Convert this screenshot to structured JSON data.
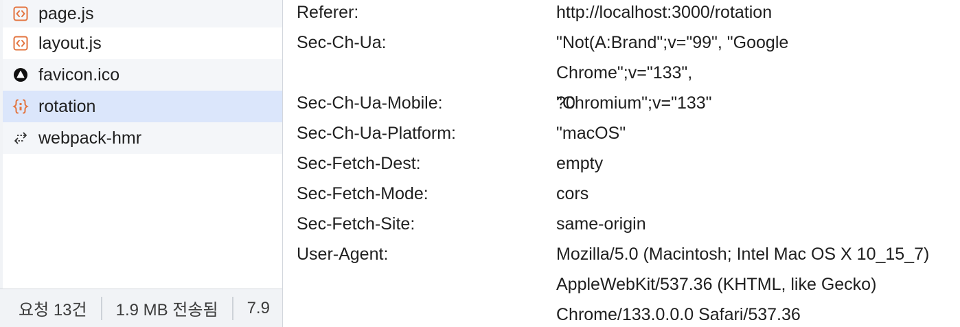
{
  "requests": [
    {
      "name": "page.js",
      "icon": "script-icon",
      "state": "normal"
    },
    {
      "name": "layout.js",
      "icon": "script-icon",
      "state": "normal"
    },
    {
      "name": "favicon.ico",
      "icon": "favicon-icon",
      "state": "normal"
    },
    {
      "name": "rotation",
      "icon": "fetch-json-icon",
      "state": "selected"
    },
    {
      "name": "webpack-hmr",
      "icon": "websocket-icon",
      "state": "normal"
    }
  ],
  "status_bar": {
    "requests": "요청 13건",
    "transferred": "1.9 MB 전송됨",
    "resources": "7.9"
  },
  "headers": [
    {
      "name": "Referer:",
      "value": "http://localhost:3000/rotation"
    },
    {
      "name": "Sec-Ch-Ua:",
      "value": "\"Not(A:Brand\";v=\"99\", \"Google Chrome\";v=\"133\", \"Chromium\";v=\"133\""
    },
    {
      "name": "Sec-Ch-Ua-Mobile:",
      "value": "?0"
    },
    {
      "name": "Sec-Ch-Ua-Platform:",
      "value": "\"macOS\""
    },
    {
      "name": "Sec-Fetch-Dest:",
      "value": "empty"
    },
    {
      "name": "Sec-Fetch-Mode:",
      "value": "cors"
    },
    {
      "name": "Sec-Fetch-Site:",
      "value": "same-origin"
    },
    {
      "name": "User-Agent:",
      "value": "Mozilla/5.0 (Macintosh; Intel Mac OS X 10_15_7) AppleWebKit/537.36 (KHTML, like Gecko) Chrome/133.0.0.0 Safari/537.36"
    }
  ],
  "colors": {
    "script_icon": "#e3743f",
    "selected_row": "#dbe6fb",
    "alt_row": "#f4f6f9",
    "divider": "#d3d7dd"
  }
}
